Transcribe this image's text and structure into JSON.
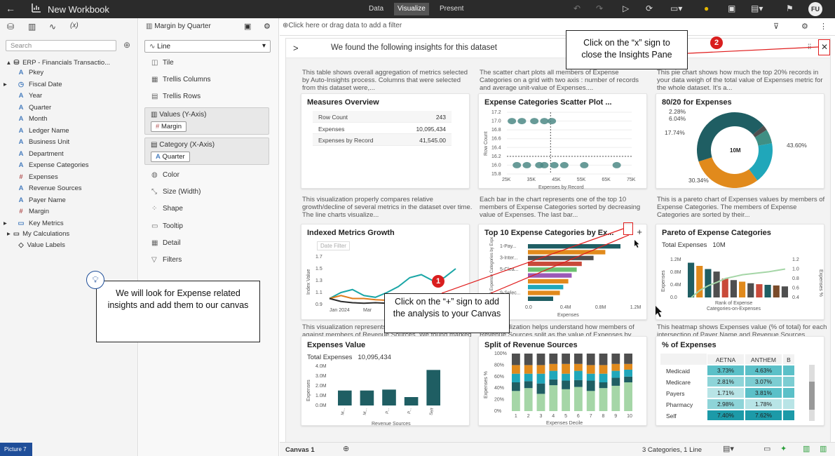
{
  "app": {
    "title": "New Workbook",
    "tabs": [
      "Data",
      "Visualize",
      "Present"
    ],
    "avatar": "FU"
  },
  "data_panel": {
    "search_placeholder": "Search",
    "source": "ERP - Financials Transactio...",
    "fields": [
      {
        "name": "Pkey",
        "type": "A"
      },
      {
        "name": "Fiscal Date",
        "type": "date"
      },
      {
        "name": "Year",
        "type": "A"
      },
      {
        "name": "Quarter",
        "type": "A"
      },
      {
        "name": "Month",
        "type": "A"
      },
      {
        "name": "Ledger Name",
        "type": "A"
      },
      {
        "name": "Business Unit",
        "type": "A"
      },
      {
        "name": "Department",
        "type": "A"
      },
      {
        "name": "Expense Categories",
        "type": "A"
      },
      {
        "name": "Expenses",
        "type": "#"
      },
      {
        "name": "Revenue Sources",
        "type": "A"
      },
      {
        "name": "Payer Name",
        "type": "A"
      },
      {
        "name": "Margin",
        "type": "#"
      },
      {
        "name": "Key Metrics",
        "type": "folder"
      }
    ],
    "my_calculations": "My Calculations",
    "value_labels": "Value Labels"
  },
  "grammar": {
    "viz_name": "Margin by Quarter",
    "chart_type": "Line",
    "items": [
      "Tile",
      "Trellis Columns",
      "Trellis Rows"
    ],
    "values_label": "Values (Y-Axis)",
    "values_pill": "Margin",
    "category_label": "Category (X-Axis)",
    "category_pill": "Quarter",
    "items2": [
      "Color",
      "Size (Width)",
      "Shape",
      "Tooltip",
      "Detail",
      "Filters"
    ]
  },
  "filter_bar": {
    "placeholder": "Click here or drag data to add a filter"
  },
  "insights": {
    "header": "We found the following insights for this dataset",
    "descs": [
      "This table shows overall aggregation of metrics selected by Auto-Insights process. Columns that were selected from this dataset were,...",
      "The scatter chart plots all members of Expense Categories on a grid with two axis : number of records and average unit-value of Expenses....",
      "This pie chart shows how much the top 20% records in your data weigh of the total value of Expenses metric for the whole dataset. It's a...",
      "This visualization properly compares relative growth/decline of several metrics in the dataset over time. The line charts visualize...",
      "Each bar in the chart represents one of the top 10 members of Expense Categories sorted by decreasing value of Expenses. The last bar...",
      "This is a pareto chart of Expenses values by members of Expense Categories. The members of Expense Categories are sorted by their...",
      "This visualization represents how Expenses distributes against members of Revenue Sources. We found marked contrast between...",
      "This visualization helps understand how members of Revenue Sources split as the value of Expenses by record groups. In this case, the...",
      "This heatmap shows Expenses value (% of total) for each intersection of Payer Name and Revenue Sources dimensions. We detected th..."
    ],
    "cards": {
      "measures": {
        "title": "Measures Overview",
        "rows": [
          [
            "Row Count",
            "243"
          ],
          [
            "Expenses",
            "10,095,434"
          ],
          [
            "Expenses by Record",
            "41,545.00"
          ]
        ]
      },
      "scatter": {
        "title": "Expense Categories Scatter Plot ..."
      },
      "pie": {
        "title": "80/20 for Expenses",
        "center": "10M"
      },
      "indexed": {
        "title": "Indexed Metrics Growth",
        "filter": "Date Filter"
      },
      "top10": {
        "title": "Top 10 Expense Categories by Ex..."
      },
      "pareto": {
        "title": "Pareto of Expense Categories",
        "total_label": "Total Expenses",
        "total_value": "10M"
      },
      "expval": {
        "title": "Expenses Value",
        "total_label": "Total Expenses",
        "total_value": "10,095,434"
      },
      "split": {
        "title": "Split of Revenue Sources"
      },
      "heat": {
        "title": "% of Expenses",
        "cols": [
          "AETNA",
          "ANTHEM",
          "B"
        ],
        "rows": [
          [
            "Medicaid",
            "3.73%",
            "4.63%"
          ],
          [
            "Medicare",
            "2.81%",
            "3.07%"
          ],
          [
            "Payers",
            "1.71%",
            "3.81%"
          ],
          [
            "Pharmacy",
            "2.98%",
            "1.78%"
          ],
          [
            "Self",
            "7.40%",
            "7.62%"
          ]
        ]
      }
    }
  },
  "chart_data": [
    {
      "type": "scatter",
      "title": "Expense Categories Scatter Plot ...",
      "xlabel": "Expenses by Record",
      "ylabel": "Row Count",
      "x_ticks": [
        "25K",
        "35K",
        "45K",
        "55K",
        "65K",
        "75K"
      ],
      "y_ticks": [
        "15.8",
        "16.0",
        "16.2",
        "16.4",
        "16.6",
        "16.8",
        "17.0",
        "17.2"
      ],
      "xlim": [
        25000,
        75000
      ],
      "ylim": [
        15.8,
        17.2
      ],
      "points": [
        [
          27000,
          17.0
        ],
        [
          31000,
          17.0
        ],
        [
          36000,
          17.0
        ],
        [
          40000,
          17.0
        ],
        [
          43000,
          17.0
        ],
        [
          29000,
          16.0
        ],
        [
          33000,
          16.0
        ],
        [
          38000,
          16.0
        ],
        [
          40000,
          16.0
        ],
        [
          44000,
          16.0
        ],
        [
          48000,
          16.0
        ],
        [
          56000,
          16.0
        ],
        [
          69000,
          16.0
        ]
      ]
    },
    {
      "type": "pie",
      "title": "80/20 for Expenses",
      "labels": [
        "2.28%",
        "6.04%",
        "17.74%",
        "30.34%",
        "43.60%"
      ],
      "values": [
        2.28,
        6.04,
        17.74,
        30.34,
        43.6
      ],
      "colors": [
        "#4f4f4f",
        "#3f8f84",
        "#20a7ba",
        "#e18a1c",
        "#1f5e63"
      ]
    },
    {
      "type": "line",
      "title": "Indexed Metrics Growth",
      "ylabel": "Index Value",
      "x_ticks": [
        "Jan 2024",
        "Mar"
      ],
      "y_ticks": [
        "0.9",
        "1.1",
        "1.3",
        "1.5",
        "1.7"
      ],
      "ylim": [
        0.9,
        1.7
      ],
      "series": [
        {
          "values": [
            1.0,
            1.1,
            1.15,
            1.05,
            1.02,
            1.1,
            1.2,
            1.35,
            1.4,
            1.3,
            1.35,
            1.5
          ],
          "color": "#1aa6a6"
        },
        {
          "values": [
            1.0,
            1.05,
            1.0,
            1.0,
            0.98,
            0.97,
            1.0,
            0.98,
            0.97,
            1.0,
            0.99,
            0.98
          ],
          "color": "#e07b1a"
        },
        {
          "values": [
            1.0,
            0.95,
            0.93,
            0.92,
            0.93,
            0.92,
            0.92,
            0.91,
            0.92,
            0.93,
            0.92,
            0.92
          ],
          "color": "#2b2b2b"
        }
      ]
    },
    {
      "type": "bar",
      "title": "Top 10 Expense Categories by Ex...",
      "xlabel": "Expenses",
      "ylabel": "Top 10 Expense Categories by Expenses",
      "categories": [
        "1-Pay...",
        "",
        "3-Inter...",
        "",
        "5-Clea...",
        "",
        "",
        "",
        "9-Selec...",
        ""
      ],
      "values": [
        1.1,
        0.92,
        0.78,
        0.64,
        0.58,
        0.52,
        0.48,
        0.42,
        0.38,
        0.3
      ],
      "x_ticks": [
        "0.0",
        "0.4M",
        "0.8M",
        "1.2M"
      ],
      "xlim": [
        0,
        1.25
      ],
      "colors": [
        "#1f5e63",
        "#e18a1c",
        "#4f4f4f",
        "#c94a3a",
        "#6cc070",
        "#9b59b6",
        "#e18a1c",
        "#20a7ba",
        "#e18a1c",
        "#1f5e63"
      ]
    },
    {
      "type": "bar",
      "title": "Pareto of Expense Categories",
      "xlabel": "Rank of Expense Categories-on-Expenses",
      "ylabel": "Expenses",
      "y2label": "Expenses %",
      "y_ticks": [
        "0.0",
        "0.4M",
        "0.8M",
        "1.2M"
      ],
      "y2_ticks": [
        "0.4",
        "0.6",
        "0.8",
        "1.0",
        "1.2"
      ],
      "ylim": [
        0,
        1.2
      ],
      "values": [
        1.1,
        1.0,
        0.9,
        0.82,
        0.6,
        0.55,
        0.5,
        0.45,
        0.42,
        0.4,
        0.38,
        0.35
      ],
      "colors": [
        "#1f5e63",
        "#e18a1c",
        "#1f5e63",
        "#4f4f4f",
        "#c94a3a",
        "#4f4f4f",
        "#e18a1c",
        "#4f4f4f",
        "#c94a3a",
        "#1f5e63",
        "#7a4b2a",
        "#4f4f4f"
      ],
      "cumulative": [
        0.4,
        0.55,
        0.65,
        0.72,
        0.8,
        0.84,
        0.88,
        0.9,
        0.92,
        0.94,
        0.97,
        1.0
      ]
    },
    {
      "type": "bar",
      "title": "Expenses Value",
      "xlabel": "Revenue Sources",
      "ylabel": "Expenses",
      "categories": [
        "M...",
        "M...",
        "P...",
        "P...",
        "Self"
      ],
      "values": [
        1.6,
        1.6,
        1.7,
        0.9,
        3.8
      ],
      "y_ticks": [
        "0.0M",
        "1.0M",
        "2.0M",
        "3.0M",
        "4.0M"
      ],
      "ylim": [
        0,
        4.2
      ]
    },
    {
      "type": "bar",
      "title": "Split of Revenue Sources",
      "xlabel": "Expenses Decile",
      "ylabel": "Expenses %",
      "categories": [
        "1",
        "2",
        "3",
        "4",
        "5",
        "6",
        "7",
        "8",
        "9",
        "10"
      ],
      "y_ticks": [
        "0%",
        "20%",
        "40%",
        "60%",
        "80%",
        "100%"
      ],
      "series": [
        {
          "values": [
            35,
            40,
            30,
            45,
            38,
            42,
            35,
            40,
            44,
            50
          ],
          "color": "#a5d6a7"
        },
        {
          "values": [
            15,
            12,
            18,
            10,
            15,
            12,
            18,
            10,
            14,
            10
          ],
          "color": "#1f5e63"
        },
        {
          "values": [
            15,
            13,
            17,
            15,
            12,
            16,
            12,
            15,
            12,
            12
          ],
          "color": "#20a7ba"
        },
        {
          "values": [
            15,
            15,
            15,
            12,
            17,
            12,
            15,
            15,
            12,
            10
          ],
          "color": "#e18a1c"
        },
        {
          "values": [
            20,
            20,
            20,
            18,
            18,
            18,
            20,
            20,
            18,
            18
          ],
          "color": "#4f4f4f"
        }
      ]
    }
  ],
  "callouts": {
    "close": "Click on the “x” sign to close the Insights Pane",
    "add": "Click on the “+” sign to add the analysis to your Canvas",
    "hint": "We will look for Expense related insights and add them to our canvas",
    "n1": "1",
    "n2": "2"
  },
  "statusbar": {
    "canvas": "Canvas 1",
    "info": "3 Categories, 1 Line"
  },
  "picture_tag": "Picture 7"
}
